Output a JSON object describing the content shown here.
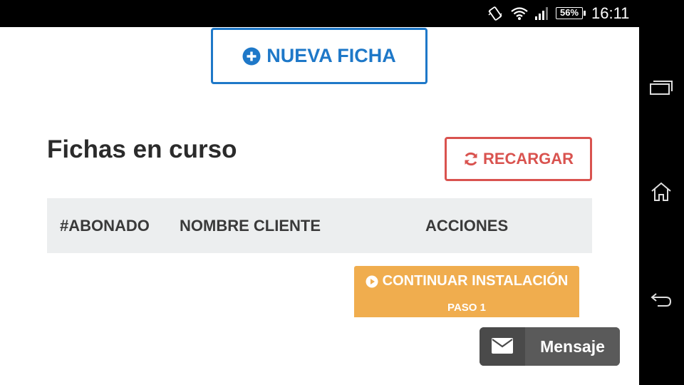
{
  "status_bar": {
    "battery": "56%",
    "time": "16:11"
  },
  "nav_bar": {
    "buttons": [
      "recent-apps-icon",
      "home-icon",
      "back-icon"
    ]
  },
  "main": {
    "new_button": {
      "label": "NUEVA FICHA",
      "icon": "plus-circle-icon"
    },
    "section_title": "Fichas en curso",
    "reload_button": {
      "label": "RECARGAR",
      "icon": "refresh-icon"
    },
    "table": {
      "headers": [
        "#ABONADO",
        "NOMBRE CLIENTE",
        "ACCIONES"
      ],
      "rows": [
        {
          "abonado": "",
          "nombre": "",
          "action": {
            "label": "CONTINUAR INSTALACIÓN",
            "sub_label": "PASO 1",
            "icon": "play-circle-icon"
          }
        }
      ]
    }
  },
  "message_widget": {
    "label": "Mensaje",
    "icon": "envelope-icon"
  },
  "colors": {
    "primary": "#1e78c8",
    "danger": "#d9534f",
    "warning": "#f0ad4e",
    "table_header_bg": "#eceeef"
  }
}
